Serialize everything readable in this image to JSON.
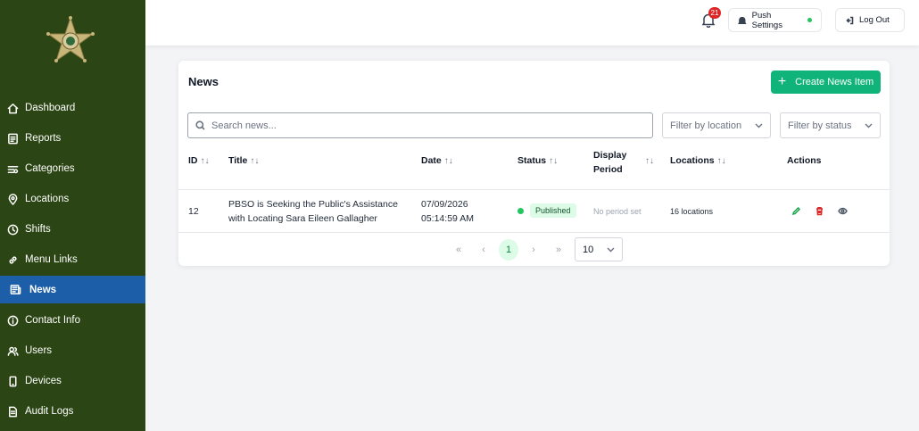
{
  "sidebar": {
    "items": [
      {
        "label": "Dashboard",
        "icon": "home-icon"
      },
      {
        "label": "Reports",
        "icon": "reports-icon"
      },
      {
        "label": "Categories",
        "icon": "categories-icon"
      },
      {
        "label": "Locations",
        "icon": "location-pin-icon"
      },
      {
        "label": "Shifts",
        "icon": "clock-icon"
      },
      {
        "label": "Menu Links",
        "icon": "link-icon"
      },
      {
        "label": "News",
        "icon": "news-icon",
        "active": true
      },
      {
        "label": "Contact Info",
        "icon": "info-icon"
      },
      {
        "label": "Users",
        "icon": "users-icon"
      },
      {
        "label": "Devices",
        "icon": "device-icon"
      },
      {
        "label": "Audit Logs",
        "icon": "audit-log-icon"
      }
    ],
    "active_color": "#1d5ea8",
    "background_color": "#2b4514"
  },
  "topbar": {
    "notification_count": "21",
    "push_settings_label": "Push Settings",
    "logout_label": "Log Out"
  },
  "news": {
    "title": "News",
    "create_label": "Create News Item",
    "search_placeholder": "Search news...",
    "filter_location": "Filter by location",
    "filter_status": "Filter by status",
    "columns": {
      "id": "ID",
      "title": "Title",
      "date": "Date",
      "status": "Status",
      "display_period_1": "Display",
      "display_period_2": "Period",
      "locations": "Locations",
      "actions": "Actions"
    },
    "rows": [
      {
        "id": "12",
        "title_line1": "PBSO is Seeking the Public's Assistance",
        "title_line2": "with Locating Sara Eileen Gallagher",
        "date_line1": "07/09/2026",
        "date_line2": "05:14:59 AM",
        "status": "Published",
        "display_period": "No period set",
        "locations": "16 locations"
      }
    ],
    "pagination": {
      "current_page": "1",
      "page_size": "10"
    },
    "accent_color": "#10b37a"
  }
}
